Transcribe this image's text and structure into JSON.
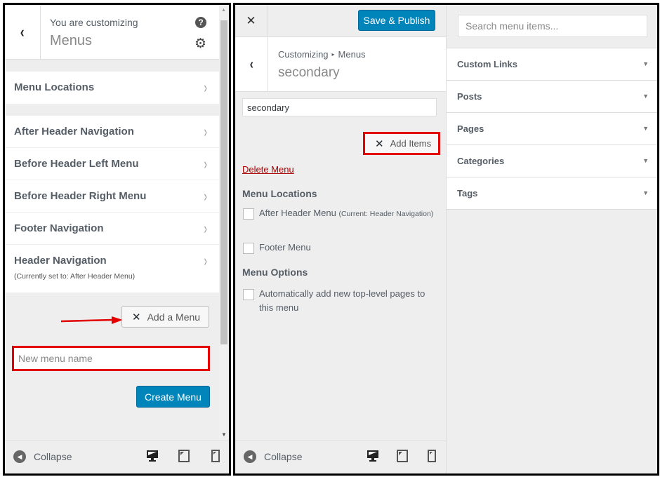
{
  "left_panel": {
    "header": {
      "subtitle": "You are customizing",
      "title": "Menus",
      "back_icon": "‹",
      "help_icon": "?",
      "gear_icon": "⚙"
    },
    "section_item": {
      "label": "Menu Locations"
    },
    "menus": [
      {
        "label": "After Header Navigation",
        "sub": ""
      },
      {
        "label": "Before Header Left Menu",
        "sub": ""
      },
      {
        "label": "Before Header Right Menu",
        "sub": ""
      },
      {
        "label": "Footer Navigation",
        "sub": ""
      },
      {
        "label": "Header Navigation",
        "sub": "(Currently set to: After Header Menu)"
      }
    ],
    "chevron": "›",
    "add_menu_button": {
      "icon": "✕",
      "label": "Add a Menu"
    },
    "new_menu_input": {
      "placeholder": "New menu name",
      "value": ""
    },
    "create_menu_button": "Create Menu",
    "scroll_up": "▲",
    "scroll_down": "▼",
    "footer": {
      "collapse_icon": "◀",
      "collapse_label": "Collapse"
    }
  },
  "right_panel": {
    "close_icon": "✕",
    "save_publish_button": "Save & Publish",
    "header": {
      "back_icon": "‹",
      "breadcrumb": [
        "Customizing",
        "Menus"
      ],
      "breadcrumb_sep": "▸",
      "title": "secondary"
    },
    "menu_name_input": {
      "value": "secondary"
    },
    "add_items_button": {
      "icon": "✕",
      "label": "Add Items"
    },
    "delete_link": "Delete Menu",
    "menu_locations": {
      "heading": "Menu Locations",
      "options": [
        {
          "label": "After Header Menu",
          "note": "(Current: Header Navigation)",
          "checked": false
        },
        {
          "label": "Footer Menu",
          "note": "",
          "checked": false
        }
      ]
    },
    "menu_options": {
      "heading": "Menu Options",
      "options": [
        {
          "label": "Automatically add new top-level pages to this menu",
          "checked": false
        }
      ]
    },
    "footer": {
      "collapse_icon": "◀",
      "collapse_label": "Collapse"
    },
    "items_panel": {
      "search_placeholder": "Search menu items...",
      "sections": [
        {
          "label": "Custom Links"
        },
        {
          "label": "Posts"
        },
        {
          "label": "Pages"
        },
        {
          "label": "Categories"
        },
        {
          "label": "Tags"
        }
      ],
      "expand_icon": "▼"
    }
  },
  "colors": {
    "primary_button": "#0085ba",
    "highlight_red": "#e30000",
    "delete_link": "#aa0000"
  }
}
